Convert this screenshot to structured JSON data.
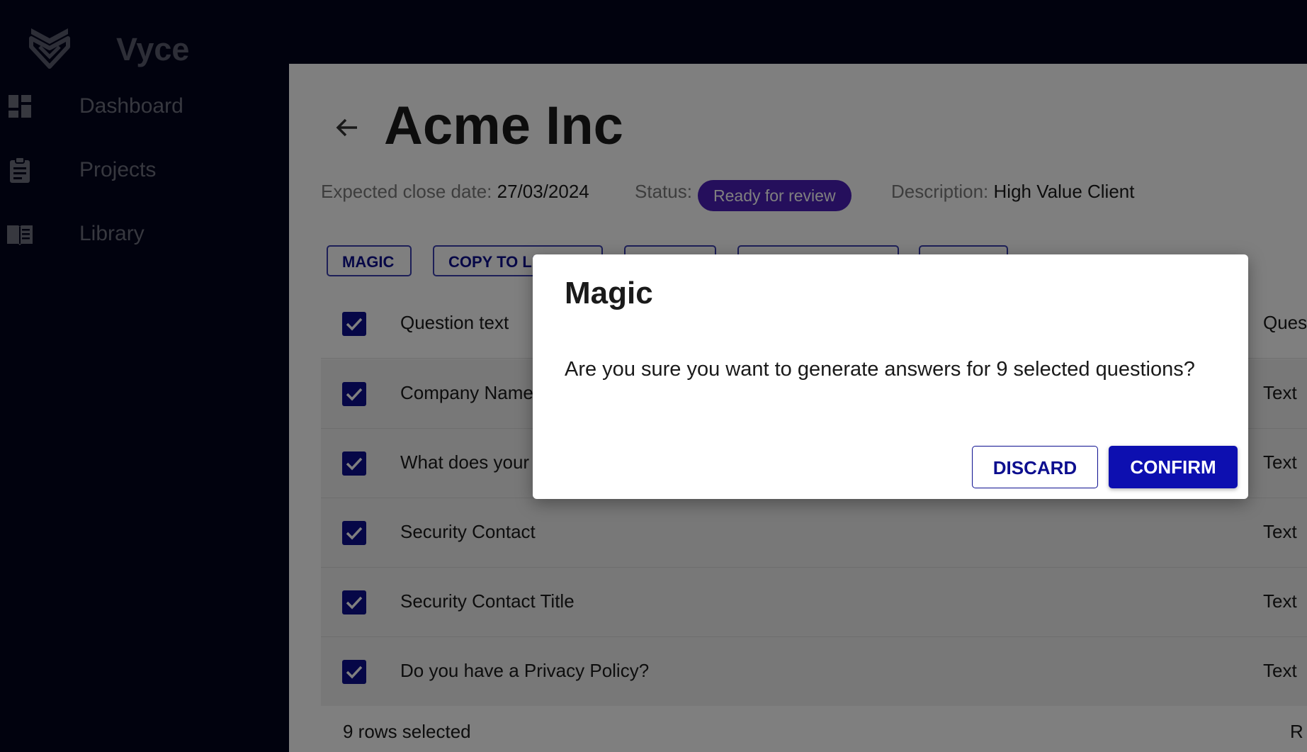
{
  "brand": {
    "name": "Vyce"
  },
  "sidebar": {
    "items": [
      {
        "label": "Dashboard",
        "icon": "dashboard-icon"
      },
      {
        "label": "Projects",
        "icon": "clipboard-icon"
      },
      {
        "label": "Library",
        "icon": "book-icon"
      }
    ]
  },
  "page": {
    "title": "Acme Inc",
    "close_date_label": "Expected close date:",
    "close_date_value": "27/03/2024",
    "status_label": "Status:",
    "status_value": "Ready for review",
    "description_label": "Description:",
    "description_value": "High Value Client"
  },
  "toolbar": {
    "magic_label": "MAGIC",
    "copy_label": "COPY TO LI"
  },
  "table": {
    "header_question": "Question text",
    "header_type": "Quest",
    "rows": [
      {
        "question": "Company Name",
        "type": "Text"
      },
      {
        "question": "What does your",
        "type": "Text"
      },
      {
        "question": "Security Contact",
        "type": "Text"
      },
      {
        "question": "Security Contact Title",
        "type": "Text"
      },
      {
        "question": "Do you have a Privacy Policy?",
        "type": "Text"
      }
    ],
    "footer_count": "9 rows selected",
    "footer_right": "R"
  },
  "dialog": {
    "title": "Magic",
    "message": "Are you sure you want to generate answers for 9 selected questions?",
    "discard_label": "DISCARD",
    "confirm_label": "CONFIRM"
  },
  "colors": {
    "sidebar_bg": "#02041d",
    "accent": "#0d0fb0",
    "status_badge": "#4a1fb8"
  }
}
